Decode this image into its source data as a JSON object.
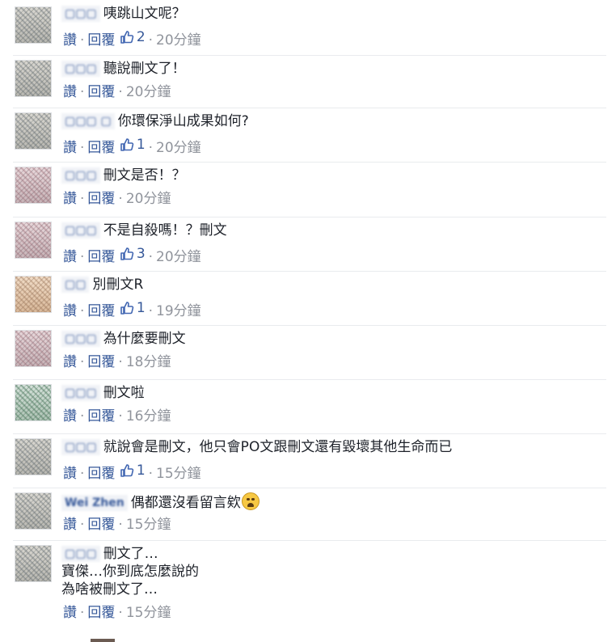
{
  "labels": {
    "like": "讚",
    "reply": "回覆",
    "separator": "·"
  },
  "comments": [
    {
      "name": "▢▢▢",
      "text": "咦跳山文呢？",
      "likes": "2",
      "time": "20分鐘"
    },
    {
      "name": "▢▢▢",
      "text": "聽說刪文了！",
      "likes": "",
      "time": "20分鐘"
    },
    {
      "name": "▢▢▢ ▢",
      "text": "你環保淨山成果如何?",
      "likes": "1",
      "time": "20分鐘"
    },
    {
      "name": "▢▢▢",
      "text": "刪文是否！？",
      "likes": "",
      "time": "20分鐘"
    },
    {
      "name": "▢▢▢",
      "text": "不是自殺嗎！？刪文",
      "likes": "3",
      "time": "20分鐘"
    },
    {
      "name": "▢▢",
      "text": "別刪文R",
      "likes": "1",
      "time": "19分鐘"
    },
    {
      "name": "▢▢▢",
      "text": "為什麼要刪文",
      "likes": "",
      "time": "18分鐘"
    },
    {
      "name": "▢▢▢",
      "text": "刪文啦",
      "likes": "",
      "time": "16分鐘"
    },
    {
      "name": "▢▢▢",
      "text": "就說會是刪文，他只會PO文跟刪文還有毀壞其他生命而已",
      "likes": "1",
      "time": "15分鐘"
    },
    {
      "name": "Wei Zhen",
      "text": "偶都還沒看留言欸",
      "emoji": "crying-face-icon",
      "likes": "",
      "time": "15分鐘"
    },
    {
      "name": "▢▢▢",
      "text": "刪文了…",
      "extra_lines": [
        "寶傑…你到底怎麼說的",
        "為啥被刪文了…"
      ],
      "likes": "",
      "time": "15分鐘"
    }
  ],
  "colors": {
    "link": "#365899",
    "meta": "#90949c",
    "text": "#1d2129"
  }
}
